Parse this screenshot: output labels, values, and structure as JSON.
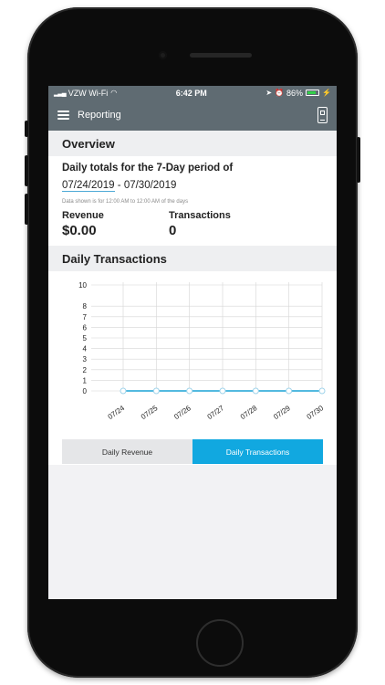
{
  "status_bar": {
    "carrier": "VZW Wi-Fi",
    "time": "6:42 PM",
    "battery_percent": "86%",
    "battery_level": 0.86,
    "battery_color": "#33d04a"
  },
  "nav": {
    "title": "Reporting",
    "menu_icon": "hamburger-icon",
    "right_icon": "card-reader-icon"
  },
  "overview": {
    "heading": "Overview",
    "period_text": "Daily totals for the 7-Day period of",
    "start_date": "07/24/2019",
    "date_separator": "-",
    "end_date": "07/30/2019",
    "note": "Data shown is for 12:00 AM to 12:00 AM of the days",
    "revenue_label": "Revenue",
    "revenue_value": "$0.00",
    "transactions_label": "Transactions",
    "transactions_value": "0"
  },
  "daily_transactions": {
    "heading": "Daily Transactions"
  },
  "chart_data": {
    "type": "line",
    "categories": [
      "07/24",
      "07/25",
      "07/26",
      "07/27",
      "07/28",
      "07/29",
      "07/30"
    ],
    "values": [
      0,
      0,
      0,
      0,
      0,
      0,
      0
    ],
    "y_ticks": [
      0,
      1,
      2,
      3,
      4,
      5,
      6,
      7,
      8,
      10
    ],
    "ylim": [
      0,
      10
    ],
    "grid": true,
    "line_color": "#1aa3d6"
  },
  "toggle": {
    "daily_revenue": "Daily Revenue",
    "daily_transactions": "Daily Transactions",
    "active": "daily_transactions",
    "active_color": "#11a8e0"
  }
}
